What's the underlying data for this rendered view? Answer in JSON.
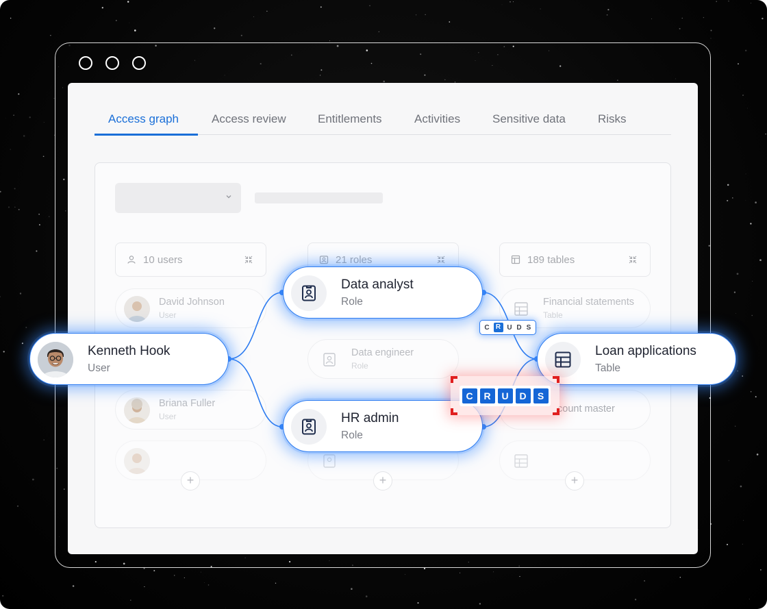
{
  "tabs": [
    {
      "label": "Access graph",
      "active": true
    },
    {
      "label": "Access review"
    },
    {
      "label": "Entitlements"
    },
    {
      "label": "Activities"
    },
    {
      "label": "Sensitive data"
    },
    {
      "label": "Risks"
    }
  ],
  "columns": {
    "users": {
      "label": "10 users",
      "icon": "user-icon"
    },
    "roles": {
      "label": "21 roles",
      "icon": "role-badge-icon"
    },
    "tables": {
      "label": "189 tables",
      "icon": "table-icon"
    }
  },
  "faded_items": {
    "users": [
      {
        "title": "David Johnson",
        "subtitle": "User"
      },
      {
        "title": "Briana Fuller",
        "subtitle": "User"
      }
    ],
    "roles": [
      {
        "title": "Data engineer",
        "subtitle": "Role"
      }
    ],
    "tables": [
      {
        "title": "Financial statements",
        "subtitle": "Table"
      },
      {
        "title": "count master",
        "subtitle": ""
      }
    ]
  },
  "nodes": {
    "user": {
      "title": "Kenneth Hook",
      "subtitle": "User"
    },
    "role1": {
      "title": "Data analyst",
      "subtitle": "Role"
    },
    "role2": {
      "title": "HR admin",
      "subtitle": "Role"
    },
    "table": {
      "title": "Loan applications",
      "subtitle": "Table"
    }
  },
  "permissions": {
    "letters": [
      "C",
      "R",
      "U",
      "D",
      "S"
    ],
    "small_active": "R"
  },
  "plus_label": "+",
  "colors": {
    "accent": "#1a6fd8",
    "highlight": "#e01f1f",
    "glow": "#3c8cff"
  }
}
